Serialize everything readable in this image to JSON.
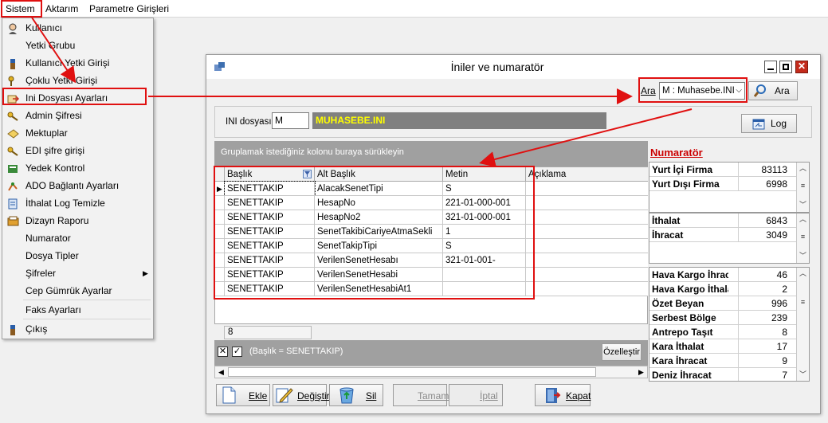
{
  "menubar": {
    "sistem": "Sistem",
    "aktarim": "Aktarım",
    "parametre": "Parametre Girişleri"
  },
  "sistem_menu": [
    {
      "label": "Kullanıcı",
      "icon": "user-icon"
    },
    {
      "label": "Yetki Grubu",
      "icon": ""
    },
    {
      "label": "Kullanıcı Yetki Girişi",
      "icon": "person-icon"
    },
    {
      "label": "Çoklu Yetki Girişi",
      "icon": "keys-icon"
    },
    {
      "label": "Ini Dosyası  Ayarları",
      "icon": "ini-arrow-icon"
    },
    {
      "label": "Admin Şifresi",
      "icon": "key-icon"
    },
    {
      "label": "Mektuplar",
      "icon": "letter-icon"
    },
    {
      "label": "EDI şifre girişi",
      "icon": "key-icon"
    },
    {
      "label": "Yedek Kontrol",
      "icon": "backup-icon"
    },
    {
      "label": "ADO Bağlantı Ayarları",
      "icon": "connection-icon"
    },
    {
      "label": "İthalat Log Temizle",
      "icon": "log-clear-icon"
    },
    {
      "label": "Dizayn Raporu",
      "icon": "report-icon"
    },
    {
      "label": "Numarator",
      "icon": ""
    },
    {
      "label": "Dosya Tipler",
      "icon": ""
    },
    {
      "label": "Şifreler",
      "icon": ""
    },
    {
      "label": "Cep Gümrük Ayarlar",
      "icon": ""
    },
    {
      "label": "Faks Ayarları",
      "icon": ""
    },
    {
      "label": "Çıkış",
      "icon": "exit-icon"
    }
  ],
  "window": {
    "title": "İniler ve numaratör",
    "ara_label": "Ara",
    "ara_select": "M : Muhasebe.INI",
    "ara_button": "Ara",
    "ini_label": "INI dosyası",
    "ini_value": "M",
    "ini_filename": "MUHASEBE.INI",
    "log_button": "Log",
    "group_hint": "Gruplamak istediğiniz kolonu buraya sürükleyin",
    "columns": [
      "Başlık",
      "Alt Başlık",
      "Metin",
      "Açıklama"
    ],
    "rows": [
      [
        "SENETTAKIP",
        "AlacakSenetTipi",
        "S",
        ""
      ],
      [
        "SENETTAKIP",
        "HesapNo",
        "221-01-000-001",
        ""
      ],
      [
        "SENETTAKIP",
        "HesapNo2",
        "321-01-000-001",
        ""
      ],
      [
        "SENETTAKIP",
        "SenetTakibiCariyeAtmaSekli",
        "1",
        ""
      ],
      [
        "SENETTAKIP",
        "SenetTakipTipi",
        "S",
        ""
      ],
      [
        "SENETTAKIP",
        "VerilenSenetHesabı",
        "321-01-001-",
        ""
      ],
      [
        "SENETTAKIP",
        "VerilenSenetHesabi",
        "",
        ""
      ],
      [
        "SENETTAKIP",
        "VerilenSenetHesabiAt1",
        "",
        ""
      ]
    ],
    "row_count": "8",
    "filter_text": "(Başlık = SENETTAKIP)",
    "customize_button": "Özelleştir",
    "buttons": {
      "ekle": "Ekle",
      "degistir": "Değiştir",
      "sil": "Sil",
      "tamam": "Tamam",
      "iptal": "İptal",
      "kapat": "Kapat"
    },
    "numarator_title": "Numaratör",
    "num_group1": [
      {
        "label": "Yurt İçi Firma",
        "value": "83113"
      },
      {
        "label": "Yurt Dışı Firma",
        "value": "6998"
      }
    ],
    "num_group2": [
      {
        "label": "İthalat",
        "value": "6843"
      },
      {
        "label": "İhracat",
        "value": "3049"
      }
    ],
    "num_group3": [
      {
        "label": "Hava Kargo İhracat",
        "value": "46"
      },
      {
        "label": "Hava Kargo İthalat",
        "value": "2"
      },
      {
        "label": "Özet Beyan",
        "value": "996"
      },
      {
        "label": "Serbest Bölge",
        "value": "239"
      },
      {
        "label": "Antrepo Taşıt",
        "value": "8"
      },
      {
        "label": "Kara İthalat",
        "value": "17"
      },
      {
        "label": "Kara İhracat",
        "value": "9"
      },
      {
        "label": "Deniz İhracat",
        "value": "7"
      }
    ]
  },
  "colors": {
    "annotation_red": "#e01010",
    "filename_yellow": "#ffff00",
    "grid_header_gray": "#a0a0a0",
    "numarator_red": "#cc0000"
  }
}
